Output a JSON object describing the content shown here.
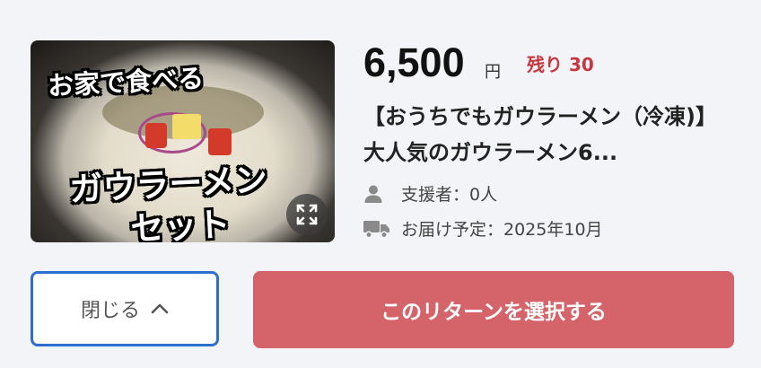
{
  "reward": {
    "image": {
      "caption_top": "お家で食べる",
      "caption_mid": "ガウラーメン",
      "caption_bot": "セット",
      "expand_icon": "expand-icon"
    },
    "price": "6,500",
    "currency": "円",
    "remaining": "残り 30",
    "title": "【おうちでもガウラーメン（冷凍)】 大人気のガウラーメン6...",
    "supporters": "支援者：0人",
    "delivery": "お届け予定：2025年10月",
    "icons": {
      "supporters": "person-icon",
      "delivery": "truck-icon"
    }
  },
  "actions": {
    "close_label": "閉じる",
    "close_icon": "chevron-up-icon",
    "select_label": "このリターンを選択する"
  },
  "colors": {
    "accent_red": "#d46469",
    "remain_red": "#c8373f",
    "close_border": "#2c6fce"
  }
}
